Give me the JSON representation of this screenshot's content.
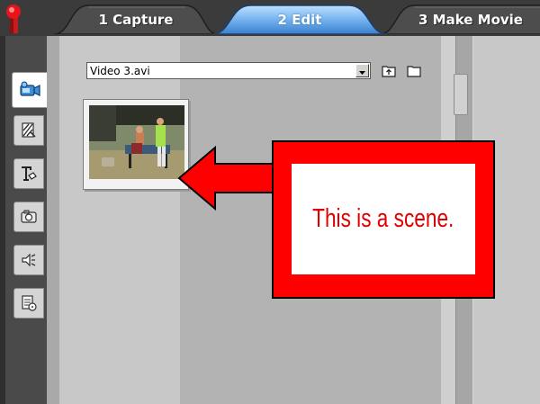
{
  "tabs": [
    {
      "label": "1 Capture",
      "state": "inactive"
    },
    {
      "label": "2 Edit",
      "state": "active"
    },
    {
      "label": "3 Make Movie",
      "state": "inactive"
    }
  ],
  "colors": {
    "accent_tab": "#4a8fd6",
    "callout_red": "#ff0000",
    "callout_text": "#e00000",
    "logo_red": "#e8141b"
  },
  "tools": [
    {
      "icon": "video-camera-icon",
      "state": "active"
    },
    {
      "icon": "transitions-icon",
      "state": "inactive"
    },
    {
      "icon": "title-text-icon",
      "state": "inactive"
    },
    {
      "icon": "photo-camera-icon",
      "state": "inactive"
    },
    {
      "icon": "sound-effects-icon",
      "state": "inactive"
    },
    {
      "icon": "music-disc-icon",
      "state": "inactive"
    }
  ],
  "album": {
    "selected_file": "Video 3.avi",
    "buttons": [
      "up-folder-icon",
      "open-folder-icon"
    ]
  },
  "callout": {
    "text": "This is a scene."
  }
}
